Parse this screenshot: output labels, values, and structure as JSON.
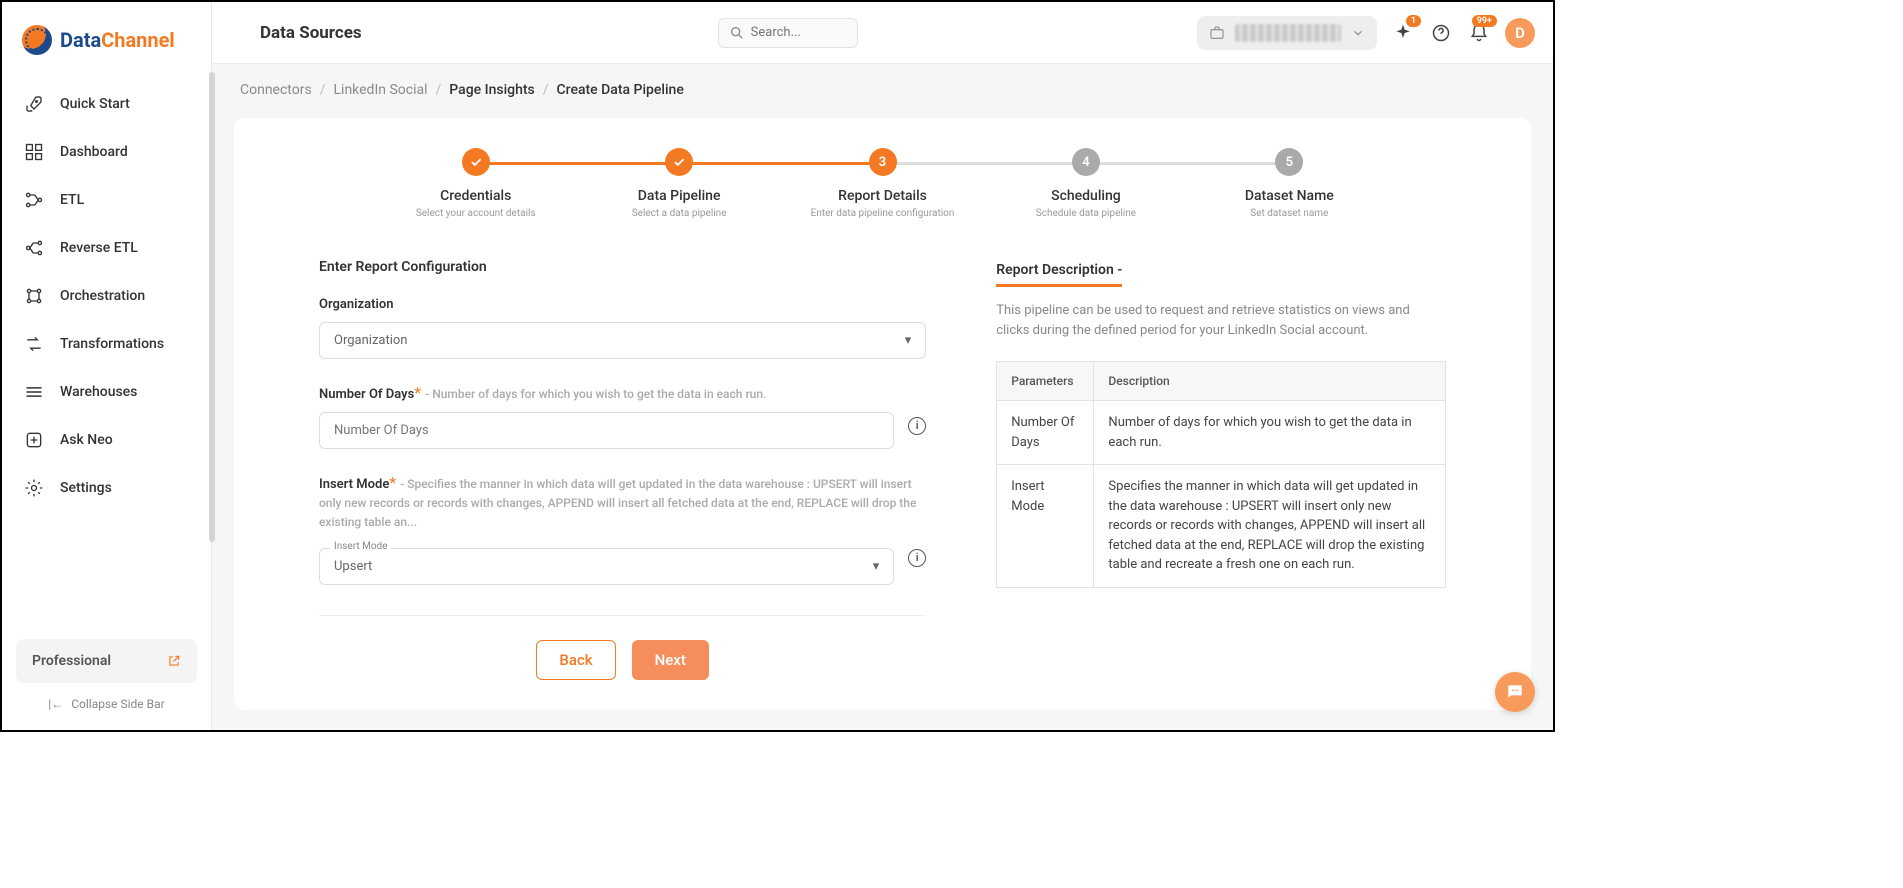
{
  "brand": {
    "name_a": "Data",
    "name_b": "Channel"
  },
  "sidebar": {
    "items": [
      {
        "label": "Quick Start"
      },
      {
        "label": "Dashboard"
      },
      {
        "label": "ETL"
      },
      {
        "label": "Reverse ETL"
      },
      {
        "label": "Orchestration"
      },
      {
        "label": "Transformations"
      },
      {
        "label": "Warehouses"
      },
      {
        "label": "Ask Neo"
      },
      {
        "label": "Settings"
      }
    ],
    "plan": "Professional",
    "collapse": "Collapse Side Bar"
  },
  "header": {
    "title": "Data Sources",
    "search_placeholder": "Search...",
    "sparkle_badge": "1",
    "bell_badge": "99+",
    "avatar_initial": "D"
  },
  "breadcrumb": {
    "items": [
      "Connectors",
      "LinkedIn Social",
      "Page Insights",
      "Create Data Pipeline"
    ]
  },
  "stepper": [
    {
      "title": "Credentials",
      "sub": "Select your account details",
      "state": "done"
    },
    {
      "title": "Data Pipeline",
      "sub": "Select a data pipeline",
      "state": "done"
    },
    {
      "title": "Report Details",
      "sub": "Enter data pipeline configuration",
      "state": "current",
      "num": "3"
    },
    {
      "title": "Scheduling",
      "sub": "Schedule data pipeline",
      "state": "pending",
      "num": "4"
    },
    {
      "title": "Dataset Name",
      "sub": "Set dataset name",
      "state": "pending",
      "num": "5"
    }
  ],
  "form": {
    "section_title": "Enter Report Configuration",
    "organization": {
      "label": "Organization",
      "placeholder": "Organization"
    },
    "num_days": {
      "label": "Number Of Days",
      "hint": "- Number of days for which you wish to get the data in each run.",
      "placeholder": "Number Of Days"
    },
    "insert_mode": {
      "label": "Insert Mode",
      "hint": "- Specifies the manner in which data will get updated in the data warehouse : UPSERT will insert only new records or records with changes, APPEND will insert all fetched data at the end, REPLACE will drop the existing table an...",
      "float_label": "Insert Mode",
      "value": "Upsert"
    },
    "back": "Back",
    "next": "Next"
  },
  "description": {
    "title": "Report Description -",
    "text": "This pipeline can be used to request and retrieve statistics on views and clicks during the defined period for your LinkedIn Social account.",
    "table_headers": [
      "Parameters",
      "Description"
    ],
    "rows": [
      {
        "param": "Number Of Days",
        "desc": "Number of days for which you wish to get the data in each run."
      },
      {
        "param": "Insert Mode",
        "desc": "Specifies the manner in which data will get updated in the data warehouse : UPSERT will insert only new records or records with changes, APPEND will insert all fetched data at the end, REPLACE will drop the existing table and recreate a fresh one on each run."
      }
    ]
  }
}
